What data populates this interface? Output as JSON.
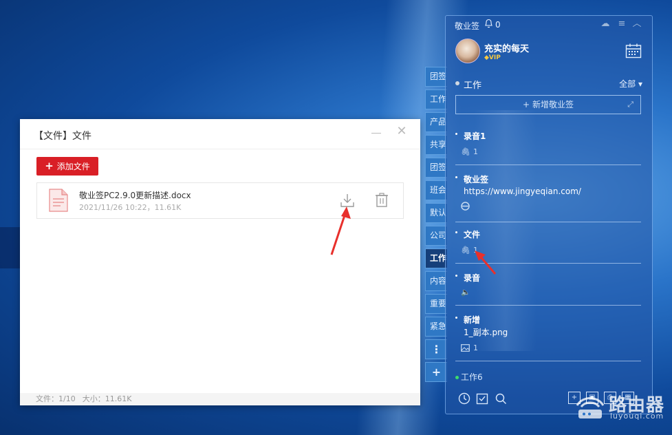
{
  "side_tabs": [
    {
      "label": "团签"
    },
    {
      "label": "工作"
    },
    {
      "label": "产品"
    },
    {
      "label": "共享"
    },
    {
      "label": "团签"
    },
    {
      "label": "班会"
    },
    {
      "label": "默认"
    },
    {
      "label": "公司"
    },
    {
      "label": "工作"
    },
    {
      "label": "内容"
    },
    {
      "label": "重要"
    },
    {
      "label": "紧急"
    },
    {
      "label": "⋮"
    },
    {
      "label": "+"
    }
  ],
  "dialog": {
    "title": "【文件】文件",
    "add_button": "添加文件",
    "file": {
      "name": "敬业签PC2.9.0更新描述.docx",
      "meta": "2021/11/26 10:22，11.61K"
    },
    "footer": {
      "count": "文件：1/10",
      "size": "大小：11.61K"
    }
  },
  "panel": {
    "brand": "敬业签",
    "bell_count": "0",
    "user": {
      "name": "充实的每天",
      "badge": "VIP"
    },
    "group": {
      "name": "工作",
      "filter": "全部"
    },
    "new_note": "新增敬业签",
    "notes": [
      {
        "title": "录音1",
        "meta": "1",
        "meta_icon": "paperclip-icon"
      },
      {
        "title": "敬业签",
        "sub": "https://www.jingyeqian.com/",
        "meta_icon": "edge-icon"
      },
      {
        "title": "文件",
        "meta": "1",
        "meta_icon": "paperclip-icon"
      },
      {
        "title": "录音",
        "meta_icon": "speaker-icon"
      },
      {
        "title": "新增",
        "sub": "1_副本.png",
        "meta": "1",
        "meta_icon": "image-icon"
      }
    ],
    "bottom_group": "工作6"
  },
  "watermark": {
    "text": "路由器",
    "sub": "luyouqi.com"
  },
  "colors": {
    "accent_red": "#d91f26",
    "panel_bg": "#2355a5",
    "green_dot": "#3ddc6b"
  }
}
